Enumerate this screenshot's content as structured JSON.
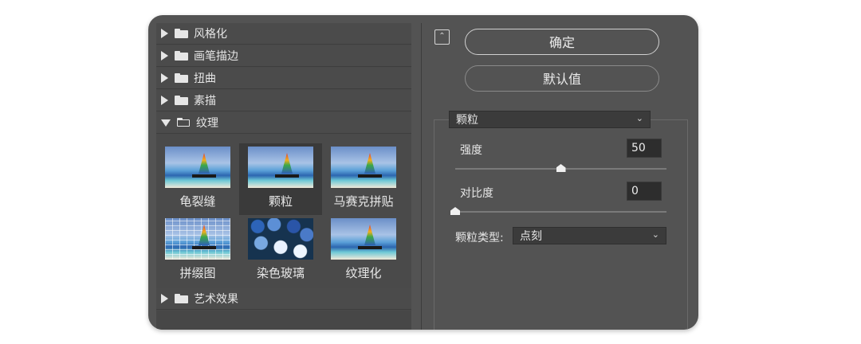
{
  "categories": {
    "stylize": "风格化",
    "brush_strokes": "画笔描边",
    "distort": "扭曲",
    "sketch": "素描",
    "texture": "纹理",
    "artistic": "艺术效果"
  },
  "texture_filters": [
    {
      "label": "龟裂缝"
    },
    {
      "label": "颗粒"
    },
    {
      "label": "马赛克拼贴"
    },
    {
      "label": "拼缀图"
    },
    {
      "label": "染色玻璃"
    },
    {
      "label": "纹理化"
    }
  ],
  "selected_filter": "颗粒",
  "buttons": {
    "collapse_icon": "⌃",
    "ok": "确定",
    "default": "默认值"
  },
  "filter_select": {
    "value": "颗粒"
  },
  "params": {
    "intensity": {
      "label": "强度",
      "value": "50",
      "fraction": 0.5
    },
    "contrast": {
      "label": "对比度",
      "value": "0",
      "fraction": 0.0
    },
    "grain_type": {
      "label": "颗粒类型:",
      "value": "点刻"
    }
  },
  "colors": {
    "dialog_bg": "#535353",
    "panel_bg": "#4a4a4a",
    "input_bg": "#2d2d2d",
    "text": "#e6e6e6"
  }
}
